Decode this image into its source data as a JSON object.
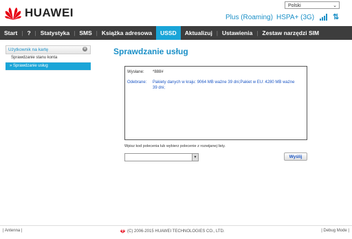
{
  "header": {
    "language": "Polski",
    "brand": "HUAWEI",
    "operator": "Plus (Roaming)",
    "network_type": "HSPA+ (3G)"
  },
  "nav": {
    "items": [
      {
        "label": "Start",
        "active": false
      },
      {
        "label": "?",
        "active": false
      },
      {
        "label": "Statystyka",
        "active": false
      },
      {
        "label": "SMS",
        "active": false
      },
      {
        "label": "Książka adresowa",
        "active": false
      },
      {
        "label": "USSD",
        "active": true
      },
      {
        "label": "Aktualizuj",
        "active": false
      },
      {
        "label": "Ustawienia",
        "active": false
      },
      {
        "label": "Zestaw narzędzi SIM",
        "active": false
      }
    ]
  },
  "sidebar": {
    "heading": "Użytkownik na kartę",
    "items": [
      {
        "label": "Sprawdzanie stanu konta",
        "active": false
      },
      {
        "label": "» Sprawdzanie usług",
        "active": true
      }
    ]
  },
  "main": {
    "title": "Sprawdzanie usług",
    "sent_label": "Wysłane:",
    "sent_value": "*888#",
    "received_label": "Odebrane:",
    "received_value": "Pakiety danych w kraju: 9064 MB ważne 39 dni;Pakiet w EU: 4280 MB ważne 39 dni;",
    "instruction": "Wpisz kod polecenia lub wybierz polecenie z rozwijanej listy.",
    "command_value": "",
    "send_label": "Wyślij"
  },
  "footer": {
    "antenna": "| Antenna |",
    "copyright": "(C) 2006-2015 HUAWEI TECHNOLOGIES CO., LTD.",
    "debug": "| Debug Mode |"
  },
  "colors": {
    "accent": "#1aa5d8",
    "navbar": "#3d3d3d",
    "link": "#1a8fc7",
    "received_text": "#1a55c4",
    "brand_red": "#e60012"
  },
  "icons": [
    "huawei-logo-icon",
    "signal-bars-icon",
    "updown-arrows-icon",
    "gear-icon",
    "dropdown-arrow-icon"
  ]
}
